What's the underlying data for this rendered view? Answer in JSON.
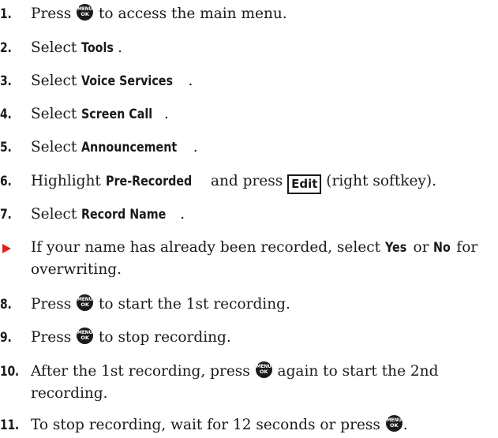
{
  "steps": [
    {
      "num": "1.",
      "pre": "Press ",
      "post": " to access the main menu."
    },
    {
      "num": "2.",
      "pre": "Select ",
      "bold": "Tools",
      "post": "."
    },
    {
      "num": "3.",
      "pre": "Select ",
      "bold": "Voice Services",
      "post": "."
    },
    {
      "num": "4.",
      "pre": "Select ",
      "bold": "Screen Call",
      "post": "."
    },
    {
      "num": "5.",
      "pre": "Select ",
      "bold": "Announcement",
      "post": "."
    },
    {
      "num": "6.",
      "pre": "Highlight ",
      "bold": "Pre-Recorded",
      "mid": " and press ",
      "key": "Edit",
      "post": " (right softkey)."
    },
    {
      "num": "7.",
      "pre": "Select ",
      "bold": "Record Name",
      "post": "."
    },
    {
      "num": "8.",
      "pre": "Press ",
      "post": " to start the 1st recording."
    },
    {
      "num": "9.",
      "pre": "Press ",
      "post": " to stop recording."
    },
    {
      "num": "10.",
      "pre": "After the 1st recording, press ",
      "post": " again to start the 2nd",
      "line2": "recording."
    },
    {
      "num": "11.",
      "pre": "To stop recording, wait for 12 seconds or press ",
      "post": "."
    }
  ],
  "note": {
    "pre": "If your name has already been recorded, select ",
    "yes": "Yes",
    "mid": " or ",
    "no": "No",
    "post": " for",
    "line2": "overwriting."
  },
  "menu_key": {
    "top": "MENU",
    "bottom": "OK"
  }
}
